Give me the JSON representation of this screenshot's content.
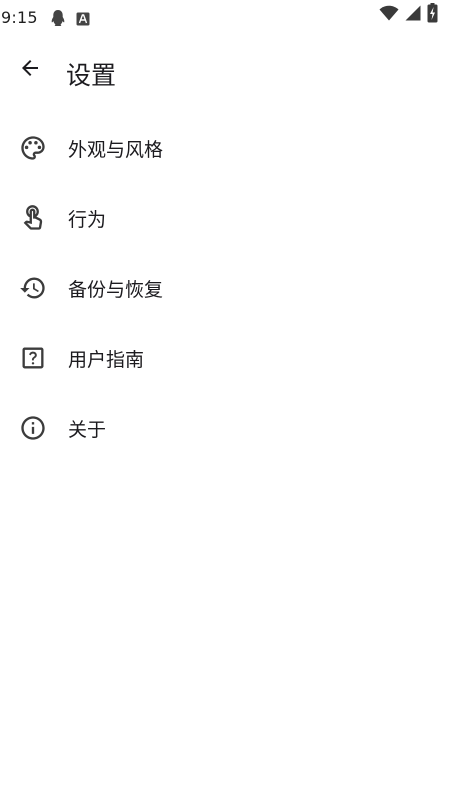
{
  "status_bar": {
    "time": "9:15",
    "left_icons": [
      "qq-penguin-icon",
      "font-a-icon"
    ],
    "right_icons": [
      "wifi-icon",
      "cellular-signal-icon",
      "battery-charging-icon"
    ]
  },
  "app_bar": {
    "back_icon": "arrow-back-icon",
    "title": "设置"
  },
  "settings": {
    "items": [
      {
        "label": "外观与风格",
        "icon": "palette-icon"
      },
      {
        "label": "行为",
        "icon": "touch-hand-icon"
      },
      {
        "label": "备份与恢复",
        "icon": "history-restore-icon"
      },
      {
        "label": "用户指南",
        "icon": "help-question-icon"
      },
      {
        "label": "关于",
        "icon": "info-icon"
      }
    ]
  },
  "colors": {
    "background": "#ffffff",
    "text": "#1c1b1f",
    "icon": "#3c3c3c"
  }
}
